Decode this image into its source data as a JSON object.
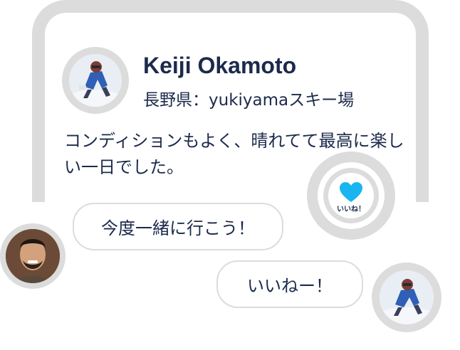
{
  "post": {
    "author": "Keiji Okamoto",
    "location": "長野県：yukiyamaスキー場",
    "body": "コンディションもよく、晴れてて最高に楽しい一日でした。"
  },
  "like": {
    "icon": "heart-icon",
    "label": "いいね！",
    "color": "#19b5f0"
  },
  "comments": [
    {
      "text": "今度一緒に行こう！",
      "avatar": "man-portrait-avatar"
    },
    {
      "text": "いいねー！",
      "avatar": "skier-avatar"
    }
  ],
  "colors": {
    "text": "#1c2a4b",
    "frame": "#dcdcdc",
    "accent": "#19b5f0"
  }
}
